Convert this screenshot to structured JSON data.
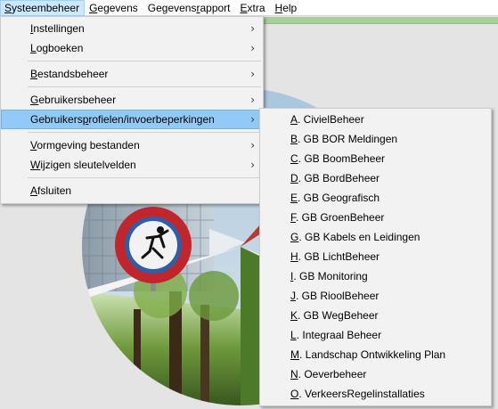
{
  "menubar": {
    "items": [
      {
        "mn": "S",
        "rest": "ysteembeheer"
      },
      {
        "mn": "G",
        "rest": "egevens"
      },
      {
        "pre": "Gegevens",
        "mn": "r",
        "rest": "apport"
      },
      {
        "mn": "E",
        "rest": "xtra"
      },
      {
        "mn": "H",
        "rest": "elp"
      }
    ]
  },
  "systeem_menu": {
    "items": [
      {
        "mn": "I",
        "rest": "nstellingen",
        "submenu": true
      },
      {
        "mn": "L",
        "rest": "ogboeken",
        "submenu": true
      },
      {
        "mn": "B",
        "rest": "estandsbeheer",
        "submenu": true
      },
      {
        "mn": "G",
        "rest": "ebruikersbeheer",
        "submenu": true
      },
      {
        "pre": "Gebruikers",
        "mn": "p",
        "rest": "rofielen/invoerbeperkingen",
        "submenu": true
      },
      {
        "mn": "V",
        "rest": "ormgeving bestanden",
        "submenu": true
      },
      {
        "mn": "W",
        "rest": "ijzigen sleutelvelden",
        "submenu": true
      },
      {
        "mn": "A",
        "rest": "fsluiten",
        "submenu": false
      }
    ],
    "arrow_glyph": "›"
  },
  "profiles_submenu": {
    "items": [
      {
        "mn": "A",
        "rest": ". CivielBeheer"
      },
      {
        "mn": "B",
        "rest": ". GB BOR Meldingen"
      },
      {
        "mn": "C",
        "rest": ". GB BoomBeheer"
      },
      {
        "mn": "D",
        "rest": ". GB BordBeheer"
      },
      {
        "mn": "E",
        "rest": ". GB Geografisch"
      },
      {
        "mn": "F",
        "rest": ". GB GroenBeheer"
      },
      {
        "mn": "G",
        "rest": ". GB Kabels en Leidingen"
      },
      {
        "mn": "H",
        "rest": ". GB LichtBeheer"
      },
      {
        "mn": "I",
        "rest": ". GB Monitoring"
      },
      {
        "mn": "J",
        "rest": ". GB RioolBeheer"
      },
      {
        "mn": "K",
        "rest": ". GB WegBeheer"
      },
      {
        "mn": "L",
        "rest": ". Integraal Beheer"
      },
      {
        "mn": "M",
        "rest": ". Landschap Ontwikkeling Plan"
      },
      {
        "mn": "N",
        "rest": ". Oeverbeheer"
      },
      {
        "mn": "O",
        "rest": ". VerkeersRegelinstallaties"
      }
    ]
  },
  "colors": {
    "highlight": "#91c9f7",
    "menubar_active": "#cce8ff",
    "accent_green": "#a8cf9a",
    "sign_red": "#c0262c",
    "sign_blue": "#2d5fa8"
  }
}
